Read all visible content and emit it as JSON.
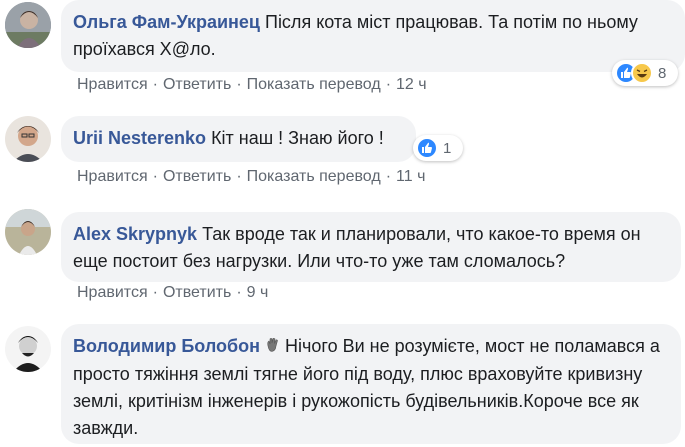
{
  "actions": {
    "like": "Нравится",
    "reply": "Ответить",
    "translate": "Показать перевод",
    "separator": "·"
  },
  "comments": [
    {
      "author": "Ольга Фам-Украинец",
      "text": "Після кота міст працював. Та потім по ньому проїхався Х@ло.",
      "time": "12 ч",
      "reactions": {
        "icons": [
          "like-icon",
          "haha-icon"
        ],
        "count": "8"
      }
    },
    {
      "author": "Urii Nesterenko",
      "text": "Кіт наш ! Знаю його !",
      "time": "11 ч",
      "reactions": {
        "icons": [
          "like-icon"
        ],
        "count": "1"
      }
    },
    {
      "author": "Alex Skrypnyk",
      "text": "Так вроде так и планировали, что какое-то время он еще постоит без нагрузки. Или что-то уже там сломалось?",
      "time": "9 ч"
    },
    {
      "author": "Володимир Болобон",
      "author_badge": "waving-hand-icon",
      "text": "Нічого Ви не розумієте, мост не поламався а просто тяжіння землі тягне його під воду, плюс враховуйте кривизну землі, критінізм інженерів і рукожопість будівельників.Короче все як завжди."
    }
  ],
  "colors": {
    "author": "#385898",
    "bubble": "#f2f3f5",
    "meta": "#606770",
    "like": "#2d88ff"
  }
}
